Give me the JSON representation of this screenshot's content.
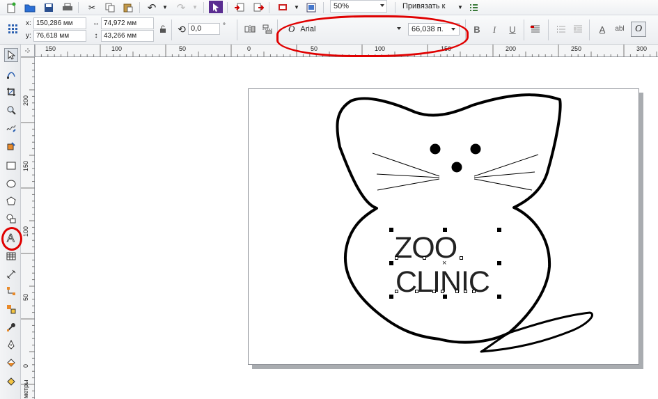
{
  "toolbar": {
    "zoom": "50%",
    "snap_label": "Привязать к"
  },
  "property_bar": {
    "x_label": "x:",
    "x_value": "150,286 мм",
    "y_label": "y:",
    "y_value": "76,618 мм",
    "width_value": "74,972 мм",
    "height_value": "43,266 мм",
    "rotation_value": "0,0",
    "rotation_unit": "°",
    "font_name": "Arial",
    "font_size": "66,038 п."
  },
  "rulers": {
    "horizontal_labels": [
      "150",
      "100",
      "50",
      "0",
      "50",
      "100",
      "150",
      "200",
      "250",
      "300"
    ],
    "vertical_labels": [
      "200",
      "150",
      "100",
      "50",
      "0"
    ],
    "unit_label": "метры"
  },
  "artwork": {
    "text_line1": "ZOO",
    "text_line2": "CLINIC"
  },
  "annotations": {
    "highlight_color": "#e00000"
  }
}
